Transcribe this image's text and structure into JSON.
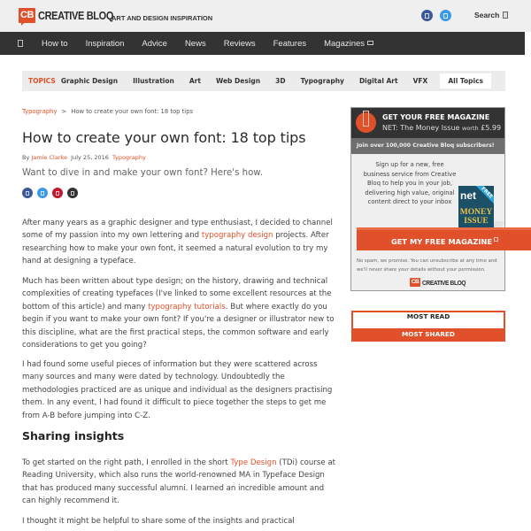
{
  "header": {
    "logo_mark": "CB",
    "logo_text": "CREATIVE BLOQ",
    "tagline": "ART AND DESIGN INSPIRATION",
    "social": [
      {
        "name": "facebook-icon",
        "color": "#3b5998"
      },
      {
        "name": "twitter-icon",
        "color": "#3b9ae8"
      }
    ],
    "search_label": "Search"
  },
  "nav": {
    "items": [
      "How to",
      "Inspiration",
      "Advice",
      "News",
      "Reviews",
      "Features",
      "Magazines"
    ]
  },
  "topics": {
    "label": "TOPICS",
    "items": [
      "Graphic Design",
      "Illustration",
      "Art",
      "Web Design",
      "3D",
      "Typography",
      "Digital Art",
      "VFX"
    ],
    "all_label": "All Topics"
  },
  "breadcrumb": {
    "section": "Typography",
    "separator": ">",
    "current": "How to create your own font: 18 top tips"
  },
  "article": {
    "title": "How to create your own font: 18 top tips",
    "by": "By",
    "author": "Jamie Clarke",
    "date": "July 25, 2016",
    "category": "Typography",
    "standfirst": "Want to dive in and make your own font? Here's how.",
    "share": [
      {
        "name": "facebook-share-icon",
        "color": "#3b5998"
      },
      {
        "name": "twitter-share-icon",
        "color": "#3b9ae8"
      },
      {
        "name": "pinterest-share-icon",
        "color": "#c4172b"
      },
      {
        "name": "email-share-icon",
        "color": "#333333"
      }
    ],
    "p1_a": "After many years as a graphic designer and type enthusiast, I decided to channel some of my passion into my own lettering and ",
    "p1_link": "typography design",
    "p1_b": " projects. After researching how to make your own font, it seemed a natural evolution to try my hand at designing a typeface.",
    "p2_a": "Much has been written about type design; on the history, drawing and technical complexities of creating typefaces (I've linked to some excellent resources at the bottom of this article) and many ",
    "p2_link": "typography tutorials",
    "p2_b": ". But where exactly do you begin if you want to make your own font? If you're a designer or illustrator new to this discipline, what are the first practical steps, the common software and early considerations to get you going?",
    "p3": "I had found some useful pieces of information but they were scattered across many sources and many were dated by technology. Undoubtedly the methodologies practiced are as unique and individual as the designers practising them. In any event, I had found it difficult to piece together the steps to get me from A-B before jumping into C-Z.",
    "h2": "Sharing insights",
    "p4_a": "To get started on the right path, I enrolled in the short ",
    "p4_link": "Type Design",
    "p4_b": " (TDi) course at Reading University, which also runs the world-renowned MA in Typeface Design that has produced many successful alumni. I learned an incredible amount and can highly recommend it.",
    "p5": "I thought it might be helpful to share some of the insights and practical"
  },
  "promo": {
    "title": "GET YOUR FREE MAGAZINE",
    "subtitle": "NET: The Money Issue",
    "worth": "worth",
    "price": "£5.99",
    "join": "Join over 100,000 Creative Bloq subscribers!",
    "copy": "Sign up for a new, free business service from Creative Bloq to help you in your job, delivering high value, original content direct to your inbox",
    "cover_net": "net",
    "cover_free": "FREE",
    "cover_line1": "MONEY",
    "cover_line2": "ISSUE",
    "cta": "GET MY FREE MAGAZINE",
    "note": "No spam, we promise. You can unsubscribe at any time and we'll never share your details without your permission.",
    "logo_mark": "CB",
    "logo_text": "CREATIVE BLOQ"
  },
  "tabs": {
    "most_read": "MOST READ",
    "most_shared": "MOST SHARED"
  },
  "colors": {
    "accent": "#e0502a",
    "nav_bg": "#333333",
    "topbar_bg": "#efefef"
  }
}
